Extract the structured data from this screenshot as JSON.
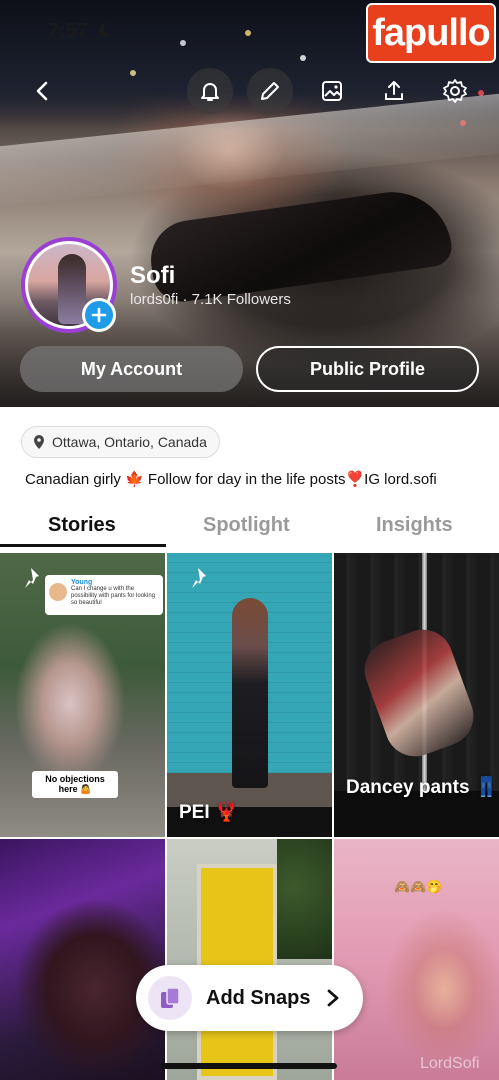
{
  "status_bar": {
    "time": "7:57"
  },
  "watermark": {
    "text": "fapullo"
  },
  "topbar": {
    "icons": [
      "back-icon",
      "bell-icon",
      "pencil-icon",
      "image-icon",
      "share-icon",
      "gear-icon"
    ]
  },
  "profile": {
    "display_name": "Sofi",
    "username_line": "lords0fi · 7.1K Followers",
    "my_account_label": "My Account",
    "public_profile_label": "Public Profile",
    "location": "Ottawa, Ontario, Canada",
    "bio": "Canadian girly 🍁 Follow for day in the life posts❣️IG lord.sofi"
  },
  "tabs": [
    {
      "label": "Stories",
      "active": true
    },
    {
      "label": "Spotlight",
      "active": false
    },
    {
      "label": "Insights",
      "active": false
    }
  ],
  "tiles": [
    {
      "caption": "",
      "note": "No objections here 🤷",
      "reply_name": "Young",
      "reply_text": "Can I change u with the possibility with pants for looking so beautiful",
      "pinned": true
    },
    {
      "caption": "PEI 🦞",
      "pinned": true
    },
    {
      "caption": "Dancey pants 👖",
      "pinned": false
    },
    {
      "caption": ""
    },
    {
      "caption": ""
    },
    {
      "caption": "",
      "emojis": "🙈🙈🤭"
    }
  ],
  "add_snaps": {
    "label": "Add Snaps"
  },
  "corner_watermark": "LordSofi"
}
